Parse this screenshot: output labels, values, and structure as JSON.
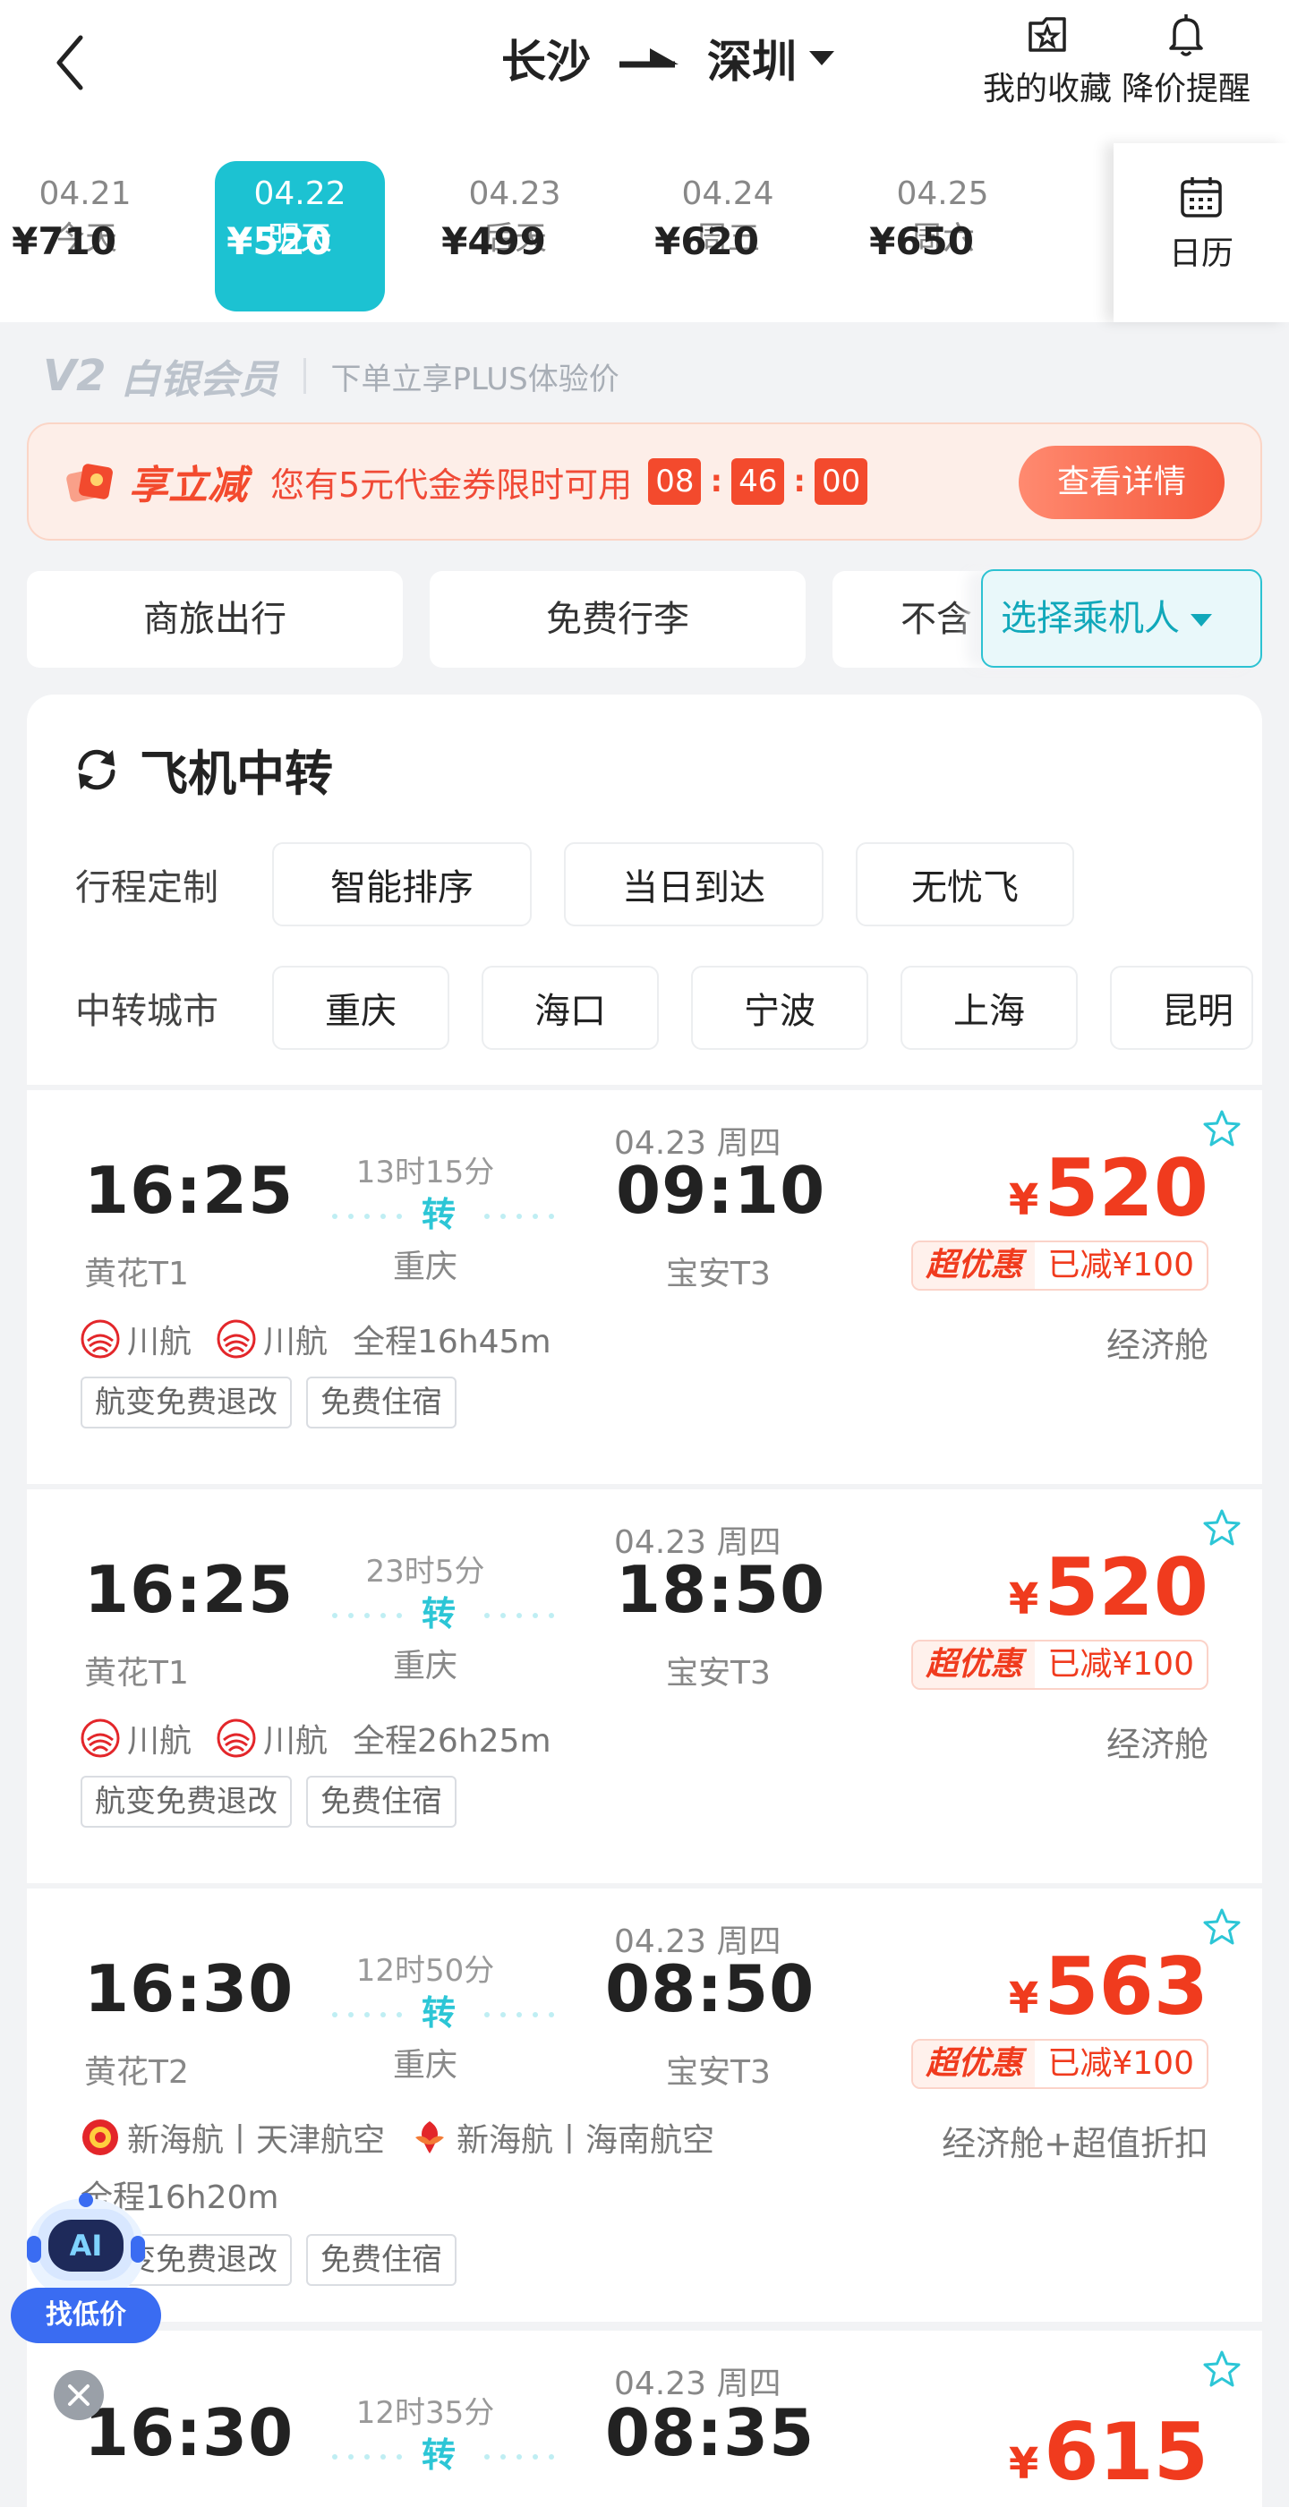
{
  "header": {
    "origin": "长沙",
    "destination": "深圳",
    "favorites_label": "我的收藏",
    "price_alert_label": "降价提醒"
  },
  "dates": [
    {
      "date": "04.21",
      "day": "今天",
      "price": "¥710"
    },
    {
      "date": "04.22",
      "day": "明天",
      "price": "¥520",
      "selected": true
    },
    {
      "date": "04.23",
      "day": "后天",
      "price": "¥499"
    },
    {
      "date": "04.24",
      "day": "周五",
      "price": "¥620"
    },
    {
      "date": "04.25",
      "day": "周六",
      "price": "¥650"
    }
  ],
  "calendar_label": "日历",
  "member": {
    "badge": "V2",
    "title": "白银会员",
    "desc": "下单立享PLUS体验价"
  },
  "promo": {
    "tag": "享立减",
    "text": "您有5元代金券限时可用",
    "timer": [
      "08",
      "46",
      "00"
    ],
    "button": "查看详情"
  },
  "filters": [
    "商旅出行",
    "免费行李",
    "不含"
  ],
  "passenger_button": "选择乘机人",
  "transfer": {
    "title": "飞机中转",
    "itinerary_label": "行程定制",
    "itinerary_options": [
      "智能排序",
      "当日到达",
      "无忧飞"
    ],
    "city_label": "中转城市",
    "cities": [
      "重庆",
      "海口",
      "宁波",
      "上海",
      "昆明"
    ]
  },
  "flights": [
    {
      "dep_time": "16:25",
      "dep_airport": "黄花T1",
      "duration": "13时15分",
      "via_label": "转",
      "via_city": "重庆",
      "arr_date": "04.23 周四",
      "arr_time": "09:10",
      "arr_airport": "宝安T3",
      "price": "520",
      "deal": "超优惠",
      "discount": "已减¥100",
      "airline1": "川航",
      "airline2": "川航",
      "total": "全程16h45m",
      "cabin": "经济舱",
      "tags": [
        "航变免费退改",
        "免费住宿"
      ]
    },
    {
      "dep_time": "16:25",
      "dep_airport": "黄花T1",
      "duration": "23时5分",
      "via_label": "转",
      "via_city": "重庆",
      "arr_date": "04.23 周四",
      "arr_time": "18:50",
      "arr_airport": "宝安T3",
      "price": "520",
      "deal": "超优惠",
      "discount": "已减¥100",
      "airline1": "川航",
      "airline2": "川航",
      "total": "全程26h25m",
      "cabin": "经济舱",
      "tags": [
        "航变免费退改",
        "免费住宿"
      ]
    },
    {
      "dep_time": "16:30",
      "dep_airport": "黄花T2",
      "duration": "12时50分",
      "via_label": "转",
      "via_city": "重庆",
      "arr_date": "04.23 周四",
      "arr_time": "08:50",
      "arr_airport": "宝安T3",
      "price": "563",
      "deal": "超优惠",
      "discount": "已减¥100",
      "airline1": "新海航丨天津航空",
      "airline2": "新海航丨海南航空",
      "total": "全程16h20m",
      "cabin": "经济舱+超值折扣",
      "tags": [
        "航变免费退改",
        "免费住宿"
      ]
    },
    {
      "dep_time": "16:30",
      "duration": "12时35分",
      "via_label": "转",
      "arr_date": "04.23 周四",
      "arr_time": "08:35",
      "price": "615"
    }
  ],
  "ai_button": "找低价",
  "colors": {
    "accent": "#1cc2d2",
    "price": "#f03b1e",
    "promo": "#f34a2d"
  }
}
